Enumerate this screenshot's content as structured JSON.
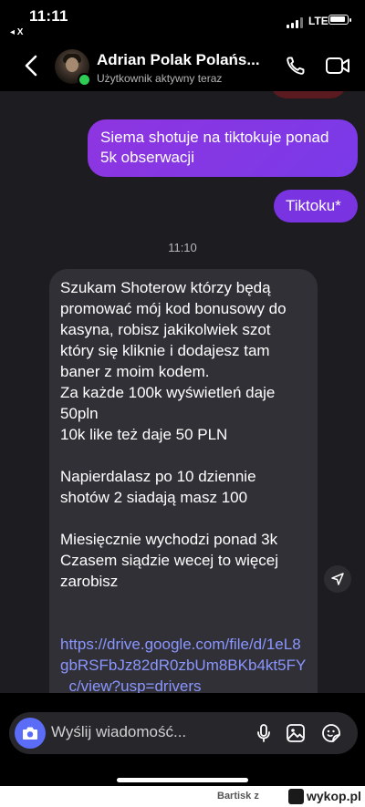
{
  "status_bar": {
    "time": "11:11",
    "back_app": "◂ X",
    "network": "LTE"
  },
  "header": {
    "contact_name": "Adrian Polak Polańs...",
    "contact_status": "Użytkownik aktywny teraz"
  },
  "messages": {
    "outgoing_1": "Siema shotuje na tiktokuje ponad 5k obserwacji",
    "outgoing_2": "Tiktoku*",
    "timestamp": "11:10",
    "incoming_lines": {
      "p1": "Szukam Shoterow którzy będą promować mój kod bonusowy do kasyna, robisz jakikolwiek szot który się kliknie i dodajesz tam baner z moim kodem.",
      "p2": "Za każde 100k wyświetleń daje 50pln",
      "p3": "10k like też daje 50 PLN",
      "p4": "Napierdalasz po 10 dziennie shotów 2 siadają masz 100",
      "p5": "Miesięcznie wychodzi ponad 3k",
      "p6": "Czasem siądzie wecej to więcej zarobisz",
      "link": "https://drive.google.com/file/d/1eL8gbRSFbJz82dR0zbUm8BKb4kt5FY_c/view?usp=drivers"
    }
  },
  "composer": {
    "placeholder": "Wyślij wiadomość..."
  },
  "watermark": {
    "user": "Bartisk z",
    "site": "wykop.pl"
  },
  "colors": {
    "outgoing_bubble": "#8e35e0",
    "incoming_bubble": "#303036",
    "link": "#8a96ff",
    "camera_button": "#5b6df7",
    "online": "#2ecc55"
  }
}
